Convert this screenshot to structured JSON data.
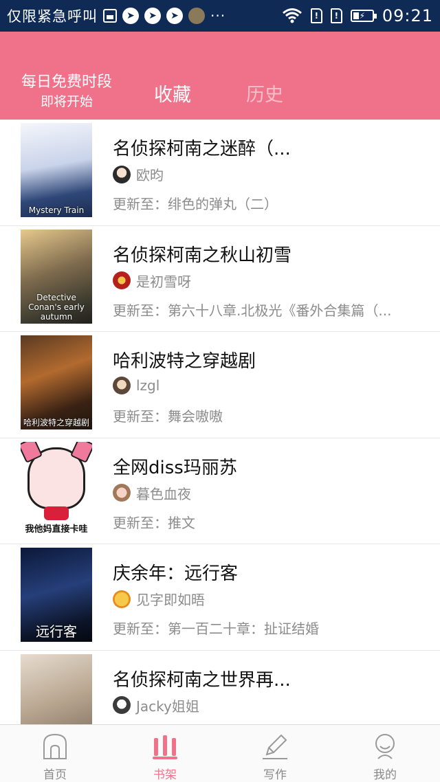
{
  "status_bar": {
    "notice": "仅限紧急呼叫",
    "dots": "···",
    "time": "09:21",
    "icons": [
      "gallery-icon",
      "bird-icon",
      "bird-icon",
      "bird-icon",
      "emoji-avatar-icon",
      "wifi-icon",
      "sim1-icon",
      "sim2-icon",
      "battery-charging-icon"
    ]
  },
  "header": {
    "free_line1": "每日免费时段",
    "free_line2": "即将开始",
    "tabs": [
      {
        "label": "收藏",
        "active": true
      },
      {
        "label": "历史",
        "active": false
      }
    ],
    "background": "#f0728a"
  },
  "books": [
    {
      "title": "名侦探柯南之迷醉（...",
      "author": "欧昀",
      "update": "更新至：绯色的弹丸（二）",
      "cover_caption": "Mystery Train"
    },
    {
      "title": "名侦探柯南之秋山初雪",
      "author": "是初雪呀",
      "update": "更新至：第六十八章.北极光《番外合集篇（...",
      "cover_caption": "Detective Conan's early autumn"
    },
    {
      "title": "哈利波特之穿越剧",
      "author": "lzgl",
      "update": "更新至：舞会嗷嗷",
      "cover_caption": "哈利波特之穿越剧"
    },
    {
      "title": "全网diss玛丽苏",
      "author": "暮色血夜",
      "update": "更新至：推文",
      "cover_caption": "我他妈直接卡哇"
    },
    {
      "title": "庆余年：远行客",
      "author": "见字即如晤",
      "update": "更新至：第一百二十章：扯证结婚",
      "cover_caption": "远行客"
    },
    {
      "title": "名侦探柯南之世界再...",
      "author": "Jacky姐姐",
      "update": "",
      "cover_caption": ""
    }
  ],
  "bottom_nav": [
    {
      "label": "首页",
      "icon": "home-icon",
      "active": false
    },
    {
      "label": "书架",
      "icon": "bookshelf-icon",
      "active": true
    },
    {
      "label": "写作",
      "icon": "pen-icon",
      "active": false
    },
    {
      "label": "我的",
      "icon": "profile-icon",
      "active": false
    }
  ],
  "colors": {
    "accent": "#f0728a",
    "status_bar": "#0e2a55",
    "secondary_text": "#8c8c8c"
  }
}
